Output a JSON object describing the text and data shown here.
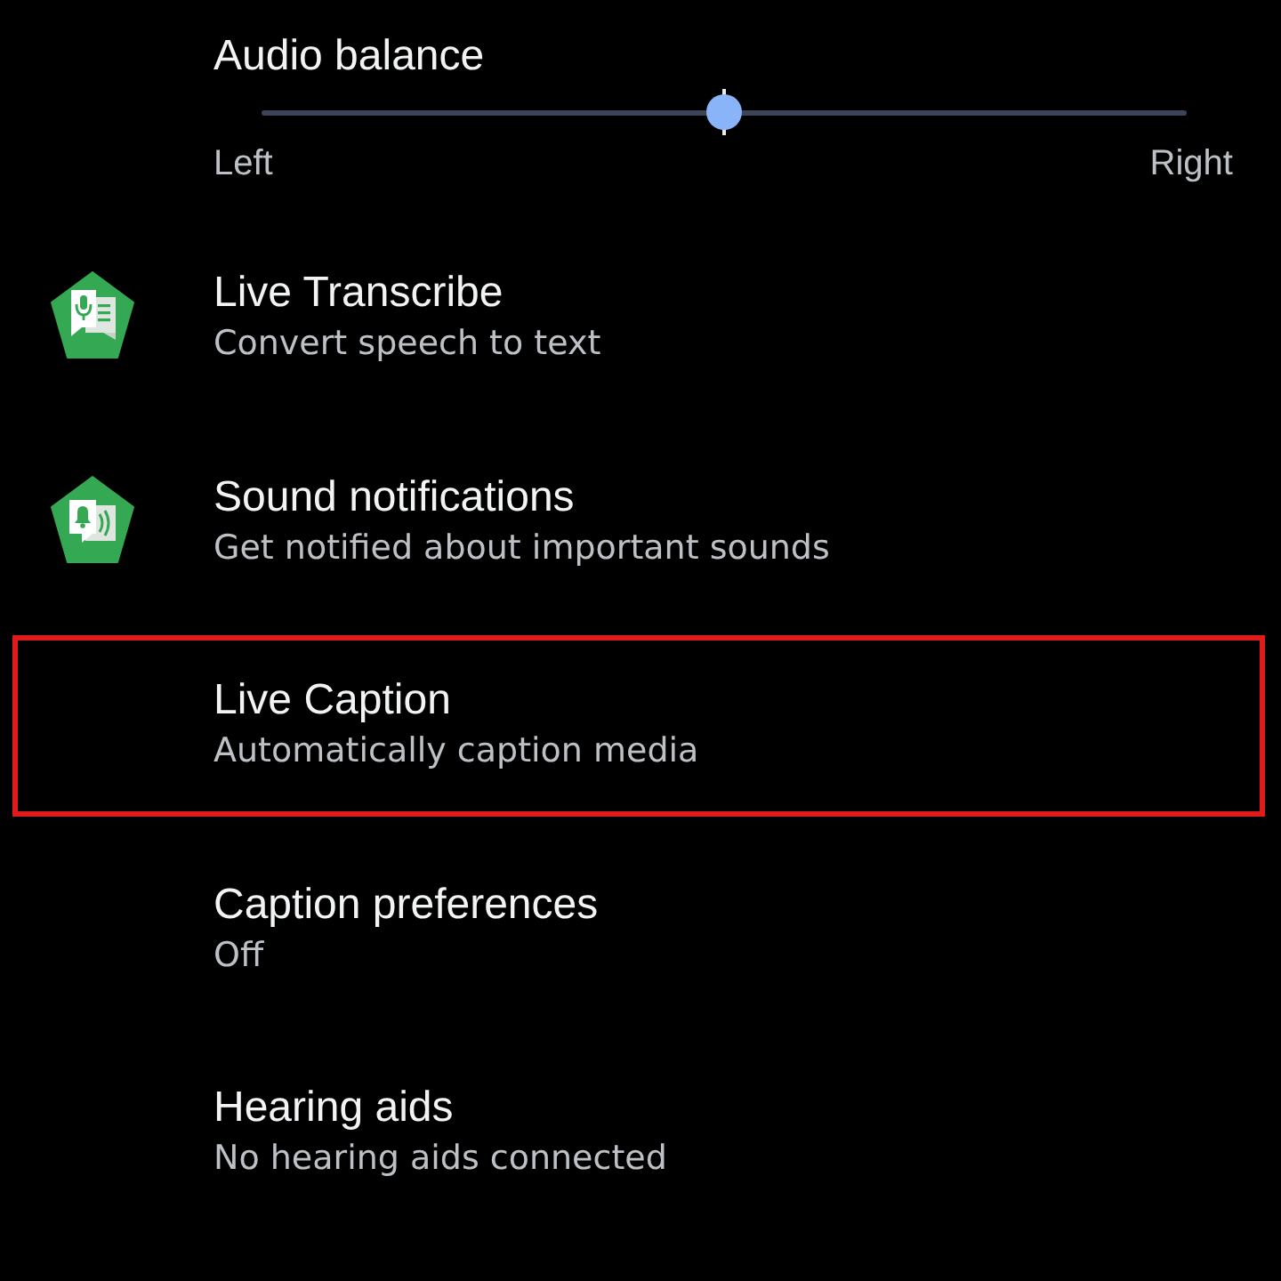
{
  "balance": {
    "title": "Audio balance",
    "level": 0.5,
    "left_label": "Left",
    "right_label": "Right"
  },
  "items": [
    {
      "kind": "transcribe",
      "title": "Live Transcribe",
      "subtitle": "Convert speech to text",
      "highlighted": false
    },
    {
      "kind": "sound-alerts",
      "title": "Sound notifications",
      "subtitle": "Get notified about important sounds",
      "highlighted": false
    },
    {
      "kind": "plain",
      "title": "Live Caption",
      "subtitle": "Automatically caption media",
      "highlighted": true
    },
    {
      "kind": "plain",
      "title": "Caption preferences",
      "subtitle": "Off",
      "highlighted": false
    },
    {
      "kind": "plain",
      "title": "Hearing aids",
      "subtitle": "No hearing aids connected",
      "highlighted": false
    }
  ]
}
